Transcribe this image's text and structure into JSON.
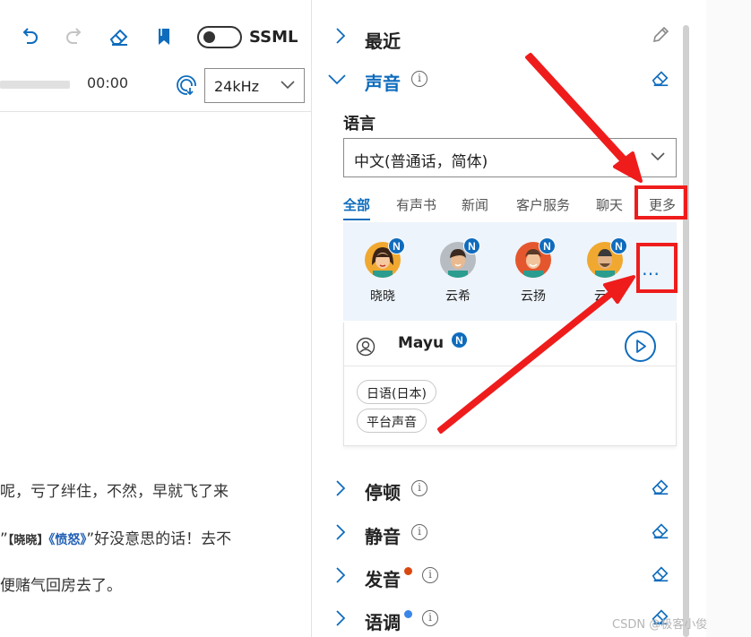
{
  "toolbar": {
    "icons": [
      "undo-icon",
      "redo-icon",
      "eraser-icon",
      "bookmark-icon"
    ],
    "ssml_label": "SSML",
    "ssml_toggle_on": false
  },
  "player": {
    "time": "00:00",
    "sample_rate": "24kHz"
  },
  "editor": {
    "line1": "呢，亏了绊住，不然，早就飞了来",
    "line2_pre": "”",
    "line2_speaker": "【晓晓】",
    "line2_emotion": "《愤怒》",
    "line2_post": "”好没意思的话！去不",
    "line3": "便赌气回房去了。"
  },
  "sections": {
    "recent": "最近",
    "voice": "声音",
    "pause": "停顿",
    "silence": "静音",
    "pronunciation": "发音",
    "intonation": "语调",
    "info_glyph": "i"
  },
  "language": {
    "label": "语言",
    "selected": "中文(普通话，简体)"
  },
  "tabs": [
    "全部",
    "有声书",
    "新闻",
    "客户服务",
    "聊天",
    "更多"
  ],
  "voices": [
    {
      "name": "晓晓",
      "badge": "N"
    },
    {
      "name": "云希",
      "badge": "N"
    },
    {
      "name": "云扬",
      "badge": "N"
    },
    {
      "name": "云",
      "badge": "N"
    }
  ],
  "more_voices": "…",
  "selected_voice": {
    "name": "Mayu",
    "badge": "N",
    "tags": [
      "日语(日本)",
      "平台声音"
    ]
  },
  "watermark": "CSDN @极客小俊",
  "colors": {
    "accent": "#0f6cbd",
    "annotation_red": "#ef1c1c",
    "dot_orange": "#d9480f",
    "dot_blue": "#3a86e8"
  }
}
